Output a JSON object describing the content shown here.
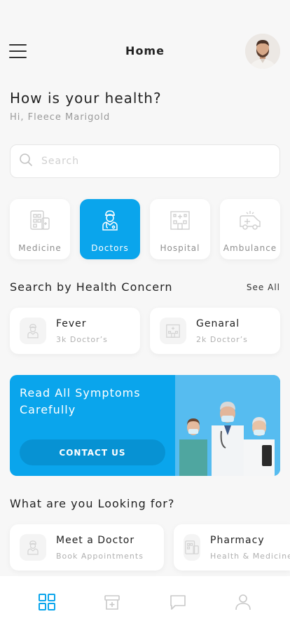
{
  "header": {
    "title": "Home",
    "menu_icon": "hamburger-menu-icon",
    "avatar": "user-avatar"
  },
  "greeting": {
    "title": "How is your health?",
    "subtitle": "Hi, Fleece Marigold"
  },
  "search": {
    "placeholder": "Search",
    "value": ""
  },
  "categories": [
    {
      "label": "Medicine",
      "icon": "medicine-icon",
      "active": false
    },
    {
      "label": "Doctors",
      "icon": "doctor-icon",
      "active": true
    },
    {
      "label": "Hospital",
      "icon": "hospital-icon",
      "active": false
    },
    {
      "label": "Ambulance",
      "icon": "ambulance-icon",
      "active": false
    }
  ],
  "concern": {
    "title": "Search by Health Concern",
    "see_all": "See All",
    "items": [
      {
        "title": "Fever",
        "subtitle": "3k Doctor’s",
        "icon": "doctor-icon"
      },
      {
        "title": "Genaral",
        "subtitle": "2k Doctor’s",
        "icon": "hospital-icon"
      }
    ]
  },
  "banner": {
    "text": "Read All Symptoms Carefully",
    "button": "CONTACT US"
  },
  "looking": {
    "title": "What are you Looking for?",
    "items": [
      {
        "title": "Meet a Doctor",
        "subtitle": "Book Appointments",
        "icon": "doctor-icon"
      },
      {
        "title": "Pharmacy",
        "subtitle": "Health & Medicine",
        "icon": "medicine-icon"
      }
    ]
  },
  "bottom_nav": [
    {
      "icon": "home-grid-icon",
      "active": true
    },
    {
      "icon": "pharmacy-box-icon",
      "active": false
    },
    {
      "icon": "chat-icon",
      "active": false
    },
    {
      "icon": "profile-icon",
      "active": false
    }
  ],
  "colors": {
    "accent": "#0aa5ec",
    "button": "#0792d3",
    "muted": "#9a9a9a",
    "icon_inactive": "#c8c8c8"
  }
}
